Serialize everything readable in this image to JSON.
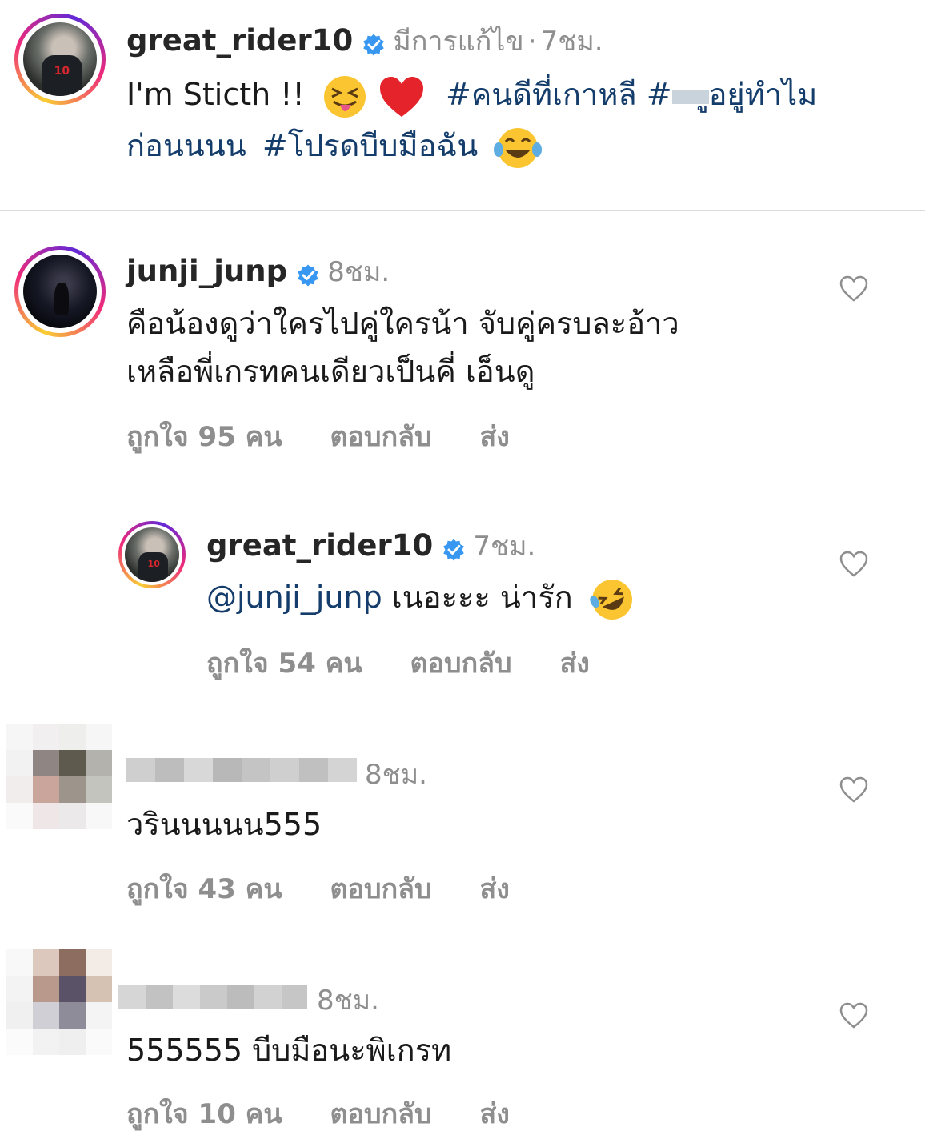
{
  "post": {
    "username": "great_rider10",
    "edited": "มีการแก้ไข",
    "separator": "·",
    "time": "7ชม.",
    "text": "I'm Sticth !!",
    "hashtag1": "#คนดีที่เกาหลี",
    "hashtag2_start": "#",
    "hashtag2_end": "ูอยู่ทำไม",
    "hashtag2_line2": "ก่อนนนน",
    "hashtag3": "#โปรดบีบมือฉัน"
  },
  "comments": [
    {
      "username": "junji_junp",
      "time": "8ชม.",
      "line1": "คือน้องดูว่าใครไปคู่ใครน้า จับคู่ครบละอ้าว",
      "line2": "เหลือพี่เกรทคนเดียวเป็นคี่ เอ็นดู",
      "likes": "ถูกใจ 95 คน",
      "reply": "ตอบกลับ",
      "send": "ส่ง"
    },
    {
      "username": "great_rider10",
      "time": "7ชม.",
      "mention": "@junji_junp",
      "text": "เนอะะะ น่ารัก",
      "likes": "ถูกใจ 54 คน",
      "reply": "ตอบกลับ",
      "send": "ส่ง"
    },
    {
      "time": "8ชม.",
      "text": "วรินนนนน555",
      "likes": "ถูกใจ 43 คน",
      "reply": "ตอบกลับ",
      "send": "ส่ง"
    },
    {
      "time": "8ชม.",
      "text": "555555 บีบมือนะพิเกรท",
      "likes": "ถูกใจ 10 คน",
      "reply": "ตอบกลับ",
      "send": "ส่ง"
    }
  ],
  "colors": {
    "hashtag": "#143d6b",
    "muted": "#8e8e8e",
    "verified": "#3897f0"
  }
}
